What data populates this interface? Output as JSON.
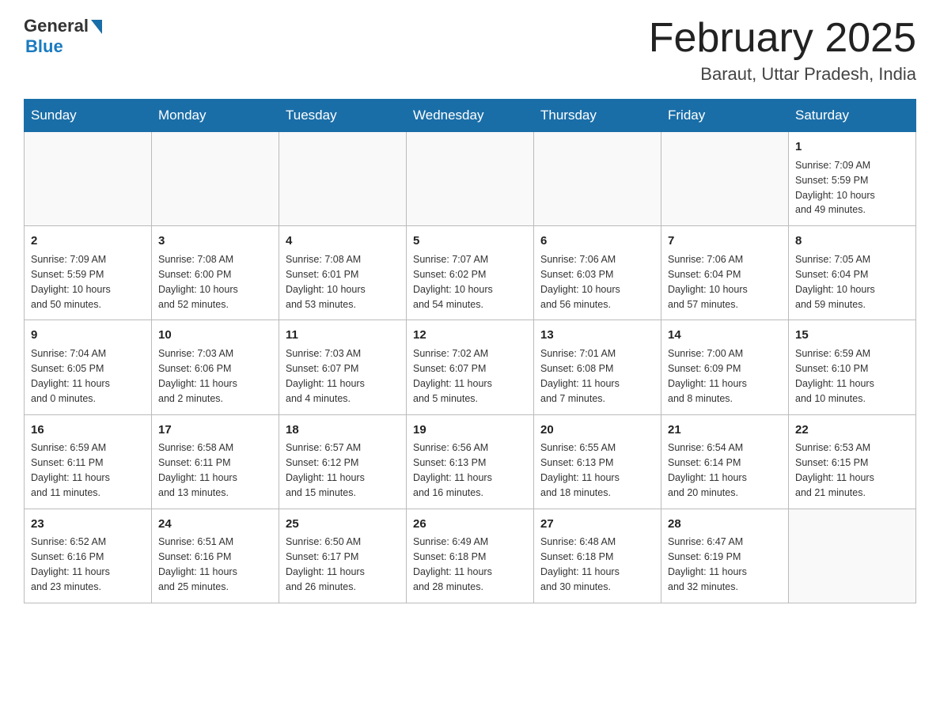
{
  "header": {
    "logo": {
      "general": "General",
      "blue": "Blue"
    },
    "title": "February 2025",
    "location": "Baraut, Uttar Pradesh, India"
  },
  "days_of_week": [
    "Sunday",
    "Monday",
    "Tuesday",
    "Wednesday",
    "Thursday",
    "Friday",
    "Saturday"
  ],
  "weeks": [
    [
      {
        "day": "",
        "info": ""
      },
      {
        "day": "",
        "info": ""
      },
      {
        "day": "",
        "info": ""
      },
      {
        "day": "",
        "info": ""
      },
      {
        "day": "",
        "info": ""
      },
      {
        "day": "",
        "info": ""
      },
      {
        "day": "1",
        "info": "Sunrise: 7:09 AM\nSunset: 5:59 PM\nDaylight: 10 hours\nand 49 minutes."
      }
    ],
    [
      {
        "day": "2",
        "info": "Sunrise: 7:09 AM\nSunset: 5:59 PM\nDaylight: 10 hours\nand 50 minutes."
      },
      {
        "day": "3",
        "info": "Sunrise: 7:08 AM\nSunset: 6:00 PM\nDaylight: 10 hours\nand 52 minutes."
      },
      {
        "day": "4",
        "info": "Sunrise: 7:08 AM\nSunset: 6:01 PM\nDaylight: 10 hours\nand 53 minutes."
      },
      {
        "day": "5",
        "info": "Sunrise: 7:07 AM\nSunset: 6:02 PM\nDaylight: 10 hours\nand 54 minutes."
      },
      {
        "day": "6",
        "info": "Sunrise: 7:06 AM\nSunset: 6:03 PM\nDaylight: 10 hours\nand 56 minutes."
      },
      {
        "day": "7",
        "info": "Sunrise: 7:06 AM\nSunset: 6:04 PM\nDaylight: 10 hours\nand 57 minutes."
      },
      {
        "day": "8",
        "info": "Sunrise: 7:05 AM\nSunset: 6:04 PM\nDaylight: 10 hours\nand 59 minutes."
      }
    ],
    [
      {
        "day": "9",
        "info": "Sunrise: 7:04 AM\nSunset: 6:05 PM\nDaylight: 11 hours\nand 0 minutes."
      },
      {
        "day": "10",
        "info": "Sunrise: 7:03 AM\nSunset: 6:06 PM\nDaylight: 11 hours\nand 2 minutes."
      },
      {
        "day": "11",
        "info": "Sunrise: 7:03 AM\nSunset: 6:07 PM\nDaylight: 11 hours\nand 4 minutes."
      },
      {
        "day": "12",
        "info": "Sunrise: 7:02 AM\nSunset: 6:07 PM\nDaylight: 11 hours\nand 5 minutes."
      },
      {
        "day": "13",
        "info": "Sunrise: 7:01 AM\nSunset: 6:08 PM\nDaylight: 11 hours\nand 7 minutes."
      },
      {
        "day": "14",
        "info": "Sunrise: 7:00 AM\nSunset: 6:09 PM\nDaylight: 11 hours\nand 8 minutes."
      },
      {
        "day": "15",
        "info": "Sunrise: 6:59 AM\nSunset: 6:10 PM\nDaylight: 11 hours\nand 10 minutes."
      }
    ],
    [
      {
        "day": "16",
        "info": "Sunrise: 6:59 AM\nSunset: 6:11 PM\nDaylight: 11 hours\nand 11 minutes."
      },
      {
        "day": "17",
        "info": "Sunrise: 6:58 AM\nSunset: 6:11 PM\nDaylight: 11 hours\nand 13 minutes."
      },
      {
        "day": "18",
        "info": "Sunrise: 6:57 AM\nSunset: 6:12 PM\nDaylight: 11 hours\nand 15 minutes."
      },
      {
        "day": "19",
        "info": "Sunrise: 6:56 AM\nSunset: 6:13 PM\nDaylight: 11 hours\nand 16 minutes."
      },
      {
        "day": "20",
        "info": "Sunrise: 6:55 AM\nSunset: 6:13 PM\nDaylight: 11 hours\nand 18 minutes."
      },
      {
        "day": "21",
        "info": "Sunrise: 6:54 AM\nSunset: 6:14 PM\nDaylight: 11 hours\nand 20 minutes."
      },
      {
        "day": "22",
        "info": "Sunrise: 6:53 AM\nSunset: 6:15 PM\nDaylight: 11 hours\nand 21 minutes."
      }
    ],
    [
      {
        "day": "23",
        "info": "Sunrise: 6:52 AM\nSunset: 6:16 PM\nDaylight: 11 hours\nand 23 minutes."
      },
      {
        "day": "24",
        "info": "Sunrise: 6:51 AM\nSunset: 6:16 PM\nDaylight: 11 hours\nand 25 minutes."
      },
      {
        "day": "25",
        "info": "Sunrise: 6:50 AM\nSunset: 6:17 PM\nDaylight: 11 hours\nand 26 minutes."
      },
      {
        "day": "26",
        "info": "Sunrise: 6:49 AM\nSunset: 6:18 PM\nDaylight: 11 hours\nand 28 minutes."
      },
      {
        "day": "27",
        "info": "Sunrise: 6:48 AM\nSunset: 6:18 PM\nDaylight: 11 hours\nand 30 minutes."
      },
      {
        "day": "28",
        "info": "Sunrise: 6:47 AM\nSunset: 6:19 PM\nDaylight: 11 hours\nand 32 minutes."
      },
      {
        "day": "",
        "info": ""
      }
    ]
  ]
}
